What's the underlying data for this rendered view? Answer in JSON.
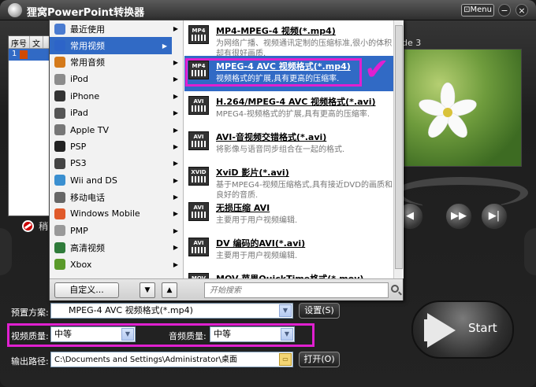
{
  "app": {
    "title": "狸窝PowerPoint转换器",
    "menu_label": "Menu"
  },
  "list": {
    "headers": [
      "序号",
      "文"
    ],
    "rows": [
      {
        "index": "1"
      }
    ],
    "partial_label": "稍"
  },
  "preview": {
    "label": "de 3"
  },
  "categories": [
    {
      "label": "最近使用",
      "icon": "clock-icon"
    },
    {
      "label": "常用视频",
      "icon": "video-icon",
      "selected": true
    },
    {
      "label": "常用音频",
      "icon": "audio-icon"
    },
    {
      "label": "iPod",
      "icon": "ipod-icon"
    },
    {
      "label": "iPhone",
      "icon": "iphone-icon"
    },
    {
      "label": "iPad",
      "icon": "ipad-icon"
    },
    {
      "label": "Apple TV",
      "icon": "appletv-icon"
    },
    {
      "label": "PSP",
      "icon": "psp-icon"
    },
    {
      "label": "PS3",
      "icon": "ps3-icon"
    },
    {
      "label": "Wii and DS",
      "icon": "wii-icon"
    },
    {
      "label": "移动电话",
      "icon": "phone-icon"
    },
    {
      "label": "Windows Mobile",
      "icon": "windows-icon"
    },
    {
      "label": "PMP",
      "icon": "pmp-icon"
    },
    {
      "label": "高清视频",
      "icon": "hd-icon"
    },
    {
      "label": "Xbox",
      "icon": "xbox-icon"
    }
  ],
  "formats": [
    {
      "badge": "MP4",
      "title": "MP4-MPEG-4 视频(*.mp4)",
      "desc": "为网络广播、视频通讯定制的压缩标准,很小的体积却有很好画质."
    },
    {
      "badge": "MP4",
      "title": "MPEG-4 AVC 视频格式(*.mp4)",
      "desc": "视频格式的扩展,具有更高的压缩率.",
      "selected": true
    },
    {
      "badge": "AVI",
      "title": "H.264/MPEG-4 AVC 视频格式(*.avi)",
      "desc": "MPEG4-视频格式的扩展,具有更高的压缩率."
    },
    {
      "badge": "AVI",
      "title": "AVI-音视频交错格式(*.avi)",
      "desc": "将影像与语音同步组合在一起的格式."
    },
    {
      "badge": "XVID",
      "title": "XviD 影片(*.avi)",
      "desc": "基于MPEG4-视频压缩格式,具有接近DVD的画质和良好的音质."
    },
    {
      "badge": "AVI",
      "title": "无损压缩 AVI",
      "desc": "主要用于用户视频编辑."
    },
    {
      "badge": "AVI",
      "title": "DV 编码的AVI(*.avi)",
      "desc": "主要用于用户视频编辑."
    },
    {
      "badge": "MOV",
      "title": "MOV-苹果QuickTime格式(*.mov)",
      "desc": ""
    }
  ],
  "popup_footer": {
    "custom_label": "自定义...",
    "search_placeholder": "开始搜索"
  },
  "settings": {
    "preset_label": "预置方案:",
    "preset_value": "MPEG-4 AVC 视频格式(*.mp4)",
    "settings_btn": "设置(S)",
    "video_quality_label": "视频质量:",
    "video_quality_value": "中等",
    "audio_quality_label": "音频质量:",
    "audio_quality_value": "中等",
    "output_label": "输出路径:",
    "output_value": "C:\\Documents and Settings\\Administrator\\桌面",
    "open_btn": "打开(O)"
  },
  "start": {
    "label": "Start"
  },
  "colors": {
    "accent": "#316ac5",
    "highlight": "#e020d0"
  }
}
